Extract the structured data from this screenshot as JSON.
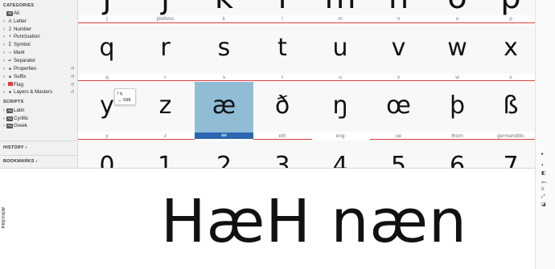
{
  "sidebar": {
    "categories_heading": "CATEGORIES",
    "categories": [
      {
        "label": "All",
        "icon": "all-badge",
        "badge": "All"
      },
      {
        "label": "Letter",
        "icon": "letter-icon",
        "glyph": "A"
      },
      {
        "label": "Number",
        "icon": "number-icon",
        "glyph": "2"
      },
      {
        "label": "Punctuation",
        "icon": "punctuation-icon",
        "glyph": "•"
      },
      {
        "label": "Symbol",
        "icon": "symbol-icon",
        "glyph": "Σ"
      },
      {
        "label": "Mark",
        "icon": "mark-icon",
        "glyph": "–"
      },
      {
        "label": "Separator",
        "icon": "separator-icon",
        "glyph": "↵"
      },
      {
        "label": "Properties",
        "icon": "properties-icon",
        "glyph": "■"
      },
      {
        "label": "Suffix",
        "icon": "suffix-icon",
        "glyph": "■"
      },
      {
        "label": "Flag",
        "icon": "flag-icon",
        "glyph": ""
      },
      {
        "label": "Layers & Masters",
        "icon": "layers-icon",
        "glyph": "■"
      }
    ],
    "scripts_heading": "SCRIPTS",
    "scripts": [
      {
        "label": "Latin",
        "badge": "Aa"
      },
      {
        "label": "Cyrillic",
        "badge": "Аа"
      },
      {
        "label": "Greek",
        "badge": "Αα"
      }
    ],
    "history_label": "HISTORY",
    "bookmarks_label": "BOOKMARKS"
  },
  "grid": {
    "row0": {
      "glyphs": [
        "j",
        "ȷ",
        "k",
        "l",
        "m",
        "n",
        "o",
        "p"
      ],
      "names": [
        "j",
        "jdotless",
        "k",
        "l",
        "m",
        "n",
        "o",
        "p"
      ]
    },
    "row1": {
      "glyphs": [
        "q",
        "r",
        "s",
        "t",
        "u",
        "v",
        "w",
        "x"
      ],
      "names": [
        "q",
        "r",
        "s",
        "t",
        "u",
        "v",
        "w",
        "x"
      ]
    },
    "row2": {
      "glyphs": [
        "y",
        "z",
        "æ",
        "ð",
        "ŋ",
        "œ",
        "þ",
        "ß"
      ],
      "names": [
        "y",
        "z",
        "ae",
        "eth",
        "eng",
        "oe",
        "thorn",
        "germandbls"
      ]
    },
    "row3": {
      "glyphs": [
        "0",
        "1",
        "2",
        "3",
        "4",
        "5",
        "6",
        "7"
      ]
    },
    "selected_index": 2
  },
  "tooltip": {
    "glyph_line": "ſ  q",
    "width_line": "↔ 598"
  },
  "preview": {
    "label": "PREVIEW",
    "text": "HæH næn"
  },
  "colors": {
    "selection": "#91bcd6",
    "selection_bar": "#2e66b0",
    "metric_line": "#d93a3a"
  }
}
